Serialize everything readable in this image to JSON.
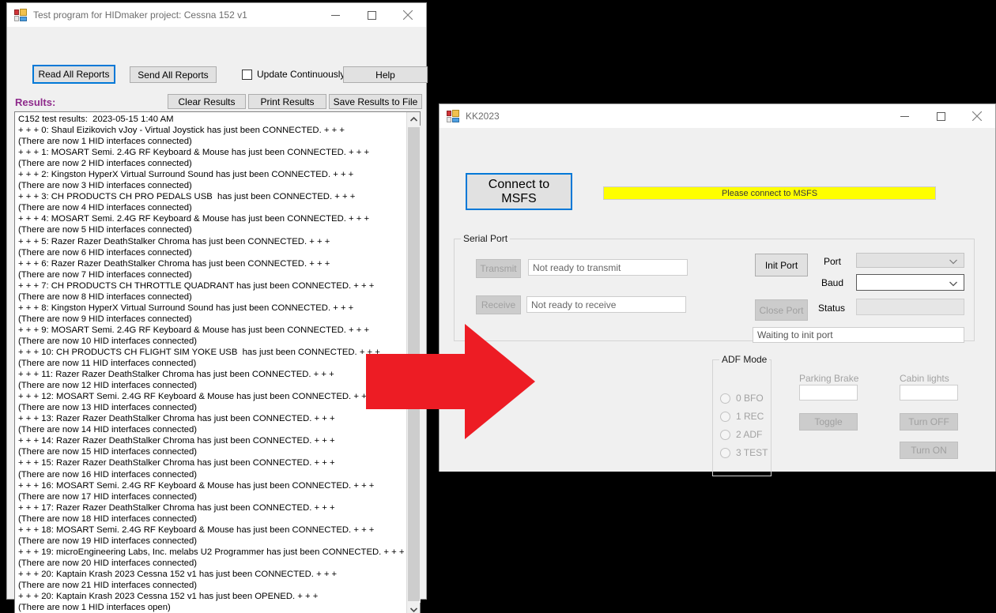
{
  "window_main": {
    "title": "Test program for HIDmaker project: Cessna 152 v1",
    "icon": "app-form-icon",
    "controls": {
      "minimize": "minimize-icon",
      "maximize": "maximize-icon",
      "close": "close-icon"
    },
    "toolbar": {
      "read_all_reports": "Read All Reports",
      "send_all_reports": "Send All Reports",
      "update_continuously": "Update Continuously",
      "update_continuously_checked": false,
      "help": "Help",
      "clear_results": "Clear Results",
      "print_results": "Print Results",
      "save_results_to_file": "Save Results to File"
    },
    "results_label": "Results:",
    "results_label_color": "#8e2a8b",
    "results_text": "C152 test results:  2023-05-15 1:40 AM\n+ + + 0: Shaul Eizikovich vJoy - Virtual Joystick has just been CONNECTED. + + +\n(There are now 1 HID interfaces connected)\n+ + + 1: MOSART Semi. 2.4G RF Keyboard & Mouse has just been CONNECTED. + + +\n(There are now 2 HID interfaces connected)\n+ + + 2: Kingston HyperX Virtual Surround Sound has just been CONNECTED. + + +\n(There are now 3 HID interfaces connected)\n+ + + 3: CH PRODUCTS CH PRO PEDALS USB  has just been CONNECTED. + + +\n(There are now 4 HID interfaces connected)\n+ + + 4: MOSART Semi. 2.4G RF Keyboard & Mouse has just been CONNECTED. + + +\n(There are now 5 HID interfaces connected)\n+ + + 5: Razer Razer DeathStalker Chroma has just been CONNECTED. + + +\n(There are now 6 HID interfaces connected)\n+ + + 6: Razer Razer DeathStalker Chroma has just been CONNECTED. + + +\n(There are now 7 HID interfaces connected)\n+ + + 7: CH PRODUCTS CH THROTTLE QUADRANT has just been CONNECTED. + + +\n(There are now 8 HID interfaces connected)\n+ + + 8: Kingston HyperX Virtual Surround Sound has just been CONNECTED. + + +\n(There are now 9 HID interfaces connected)\n+ + + 9: MOSART Semi. 2.4G RF Keyboard & Mouse has just been CONNECTED. + + +\n(There are now 10 HID interfaces connected)\n+ + + 10: CH PRODUCTS CH FLIGHT SIM YOKE USB  has just been CONNECTED. + + +\n(There are now 11 HID interfaces connected)\n+ + + 11: Razer Razer DeathStalker Chroma has just been CONNECTED. + + +\n(There are now 12 HID interfaces connected)\n+ + + 12: MOSART Semi. 2.4G RF Keyboard & Mouse has just been CONNECTED. + + +\n(There are now 13 HID interfaces connected)\n+ + + 13: Razer Razer DeathStalker Chroma has just been CONNECTED. + + +\n(There are now 14 HID interfaces connected)\n+ + + 14: Razer Razer DeathStalker Chroma has just been CONNECTED. + + +\n(There are now 15 HID interfaces connected)\n+ + + 15: Razer Razer DeathStalker Chroma has just been CONNECTED. + + +\n(There are now 16 HID interfaces connected)\n+ + + 16: MOSART Semi. 2.4G RF Keyboard & Mouse has just been CONNECTED. + + +\n(There are now 17 HID interfaces connected)\n+ + + 17: Razer Razer DeathStalker Chroma has just been CONNECTED. + + +\n(There are now 18 HID interfaces connected)\n+ + + 18: MOSART Semi. 2.4G RF Keyboard & Mouse has just been CONNECTED. + + +\n(There are now 19 HID interfaces connected)\n+ + + 19: microEngineering Labs, Inc. melabs U2 Programmer has just been CONNECTED. + + +\n(There are now 20 HID interfaces connected)\n+ + + 20: Kaptain Krash 2023 Cessna 152 v1 has just been CONNECTED. + + +\n(There are now 21 HID interfaces connected)\n+ + + 20: Kaptain Krash 2023 Cessna 152 v1 has just been OPENED. + + +\n(There are now 1 HID interfaces open)"
  },
  "window_kk": {
    "title": "KK2023",
    "icon": "app-form-icon",
    "controls": {
      "minimize": "minimize-icon",
      "maximize": "maximize-icon",
      "close": "close-icon"
    },
    "connect_button": "Connect to MSFS",
    "status_banner": "Please connect to MSFS",
    "status_banner_color": "#ffff00",
    "serial_port": {
      "group_label": "Serial Port",
      "transmit_button": "Transmit",
      "transmit_status": "Not ready to transmit",
      "receive_button": "Receive",
      "receive_status": "Not ready to receive",
      "init_port_button": "Init Port",
      "close_port_button": "Close Port",
      "port_label": "Port",
      "port_value": "",
      "baud_label": "Baud",
      "baud_value": "",
      "status_label": "Status",
      "status_value": "",
      "port_state_text": "Waiting to init port"
    },
    "adf_mode": {
      "group_label": "ADF Mode",
      "options": [
        {
          "label": "0 BFO",
          "checked": false
        },
        {
          "label": "1 REC",
          "checked": false
        },
        {
          "label": "2 ADF",
          "checked": false
        },
        {
          "label": "3 TEST",
          "checked": false
        }
      ]
    },
    "parking_brake": {
      "label": "Parking Brake",
      "value": "",
      "toggle_button": "Toggle"
    },
    "cabin_lights": {
      "label": "Cabin lights",
      "value": "",
      "turn_off_button": "Turn OFF",
      "turn_on_button": "Turn ON"
    }
  },
  "annotation": {
    "arrow": "red-right-arrow",
    "arrow_color": "#ed1c24"
  }
}
